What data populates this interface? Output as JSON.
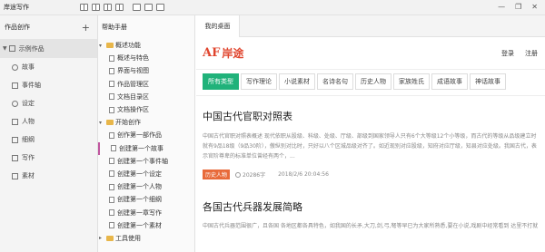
{
  "app": {
    "title": "岸途写作",
    "window_controls": [
      "—",
      "❐",
      "✕"
    ]
  },
  "toolbar": {
    "icons": [
      "layout-icon",
      "layout-icon",
      "layout-icon",
      "layout-icon",
      "layout-icon",
      "layout-icon",
      "layout-icon"
    ]
  },
  "sidebar": {
    "header": "作品创作",
    "add_label": "+",
    "project": "示例作品",
    "items": [
      {
        "label": "故事"
      },
      {
        "label": "事件轴"
      },
      {
        "label": "设定"
      },
      {
        "label": "人物"
      },
      {
        "label": "细纲"
      },
      {
        "label": "写作"
      },
      {
        "label": "素材"
      }
    ]
  },
  "manual": {
    "header": "帮助手册",
    "tree": [
      {
        "label": "概述功能",
        "type": "folder",
        "level": 0,
        "expanded": true
      },
      {
        "label": "概述与特色",
        "type": "doc",
        "level": 1
      },
      {
        "label": "界面与视图",
        "type": "doc",
        "level": 1
      },
      {
        "label": "作品管理区",
        "type": "doc",
        "level": 1
      },
      {
        "label": "文档目录区",
        "type": "doc",
        "level": 1
      },
      {
        "label": "文档操作区",
        "type": "doc",
        "level": 1
      },
      {
        "label": "开始创作",
        "type": "folder",
        "level": 0,
        "expanded": true
      },
      {
        "label": "创作第一部作品",
        "type": "doc",
        "level": 1
      },
      {
        "label": "创建第一个故事",
        "type": "doc",
        "level": 1
      },
      {
        "label": "创建第一个事件轴",
        "type": "doc",
        "level": 1
      },
      {
        "label": "创建第一个设定",
        "type": "doc",
        "level": 1
      },
      {
        "label": "创建第一个人物",
        "type": "doc",
        "level": 1
      },
      {
        "label": "创建第一个细纲",
        "type": "doc",
        "level": 1
      },
      {
        "label": "创建第一章写作",
        "type": "doc",
        "level": 1
      },
      {
        "label": "创建第一个素材",
        "type": "doc",
        "level": 1
      },
      {
        "label": "工具使用",
        "type": "folder",
        "level": 0,
        "expanded": false
      }
    ]
  },
  "desk": {
    "tab": "我的桌面",
    "logo_mark": "AF",
    "logo_text": "岸途",
    "login": "登录",
    "register": "注册",
    "categories": [
      "所有类型",
      "写作理论",
      "小说素材",
      "名诗名句",
      "历史人物",
      "家族姓氏",
      "成语故事",
      "神话故事"
    ],
    "active_category": 0,
    "articles": [
      {
        "title": "中国古代官职对照表",
        "summary": "中国古代官职对照表概述 现代依职从股级、科级、处级、厅级、部级到国家领导人只有6个大等级12个小等级，而古代的等级从品级建立时就有9品18级（9品30阶），傲纵别对比时，只好以八个区城品级对齐了。如近现别对应股级，知府对应厅级，知县对应处级。我国古代，表示官阶尊卑的标准单位曾经有两个，...",
        "tag": "历史人物",
        "views": "20286字",
        "date": "2018/2/6 20:04:56"
      },
      {
        "title": "各国古代兵器发展简略",
        "summary": "中国古代兵器范围很广，且各国 各地区都各具特色，如我国的长矛,大刀,剑,弓,弩等早已为大家所熟悉,要在小说,戏剧中经常看到 达里不打就不说各国古代兵器的形状 仅仅简单 而是对于代兵器的发展简略，那么..."
      }
    ]
  }
}
